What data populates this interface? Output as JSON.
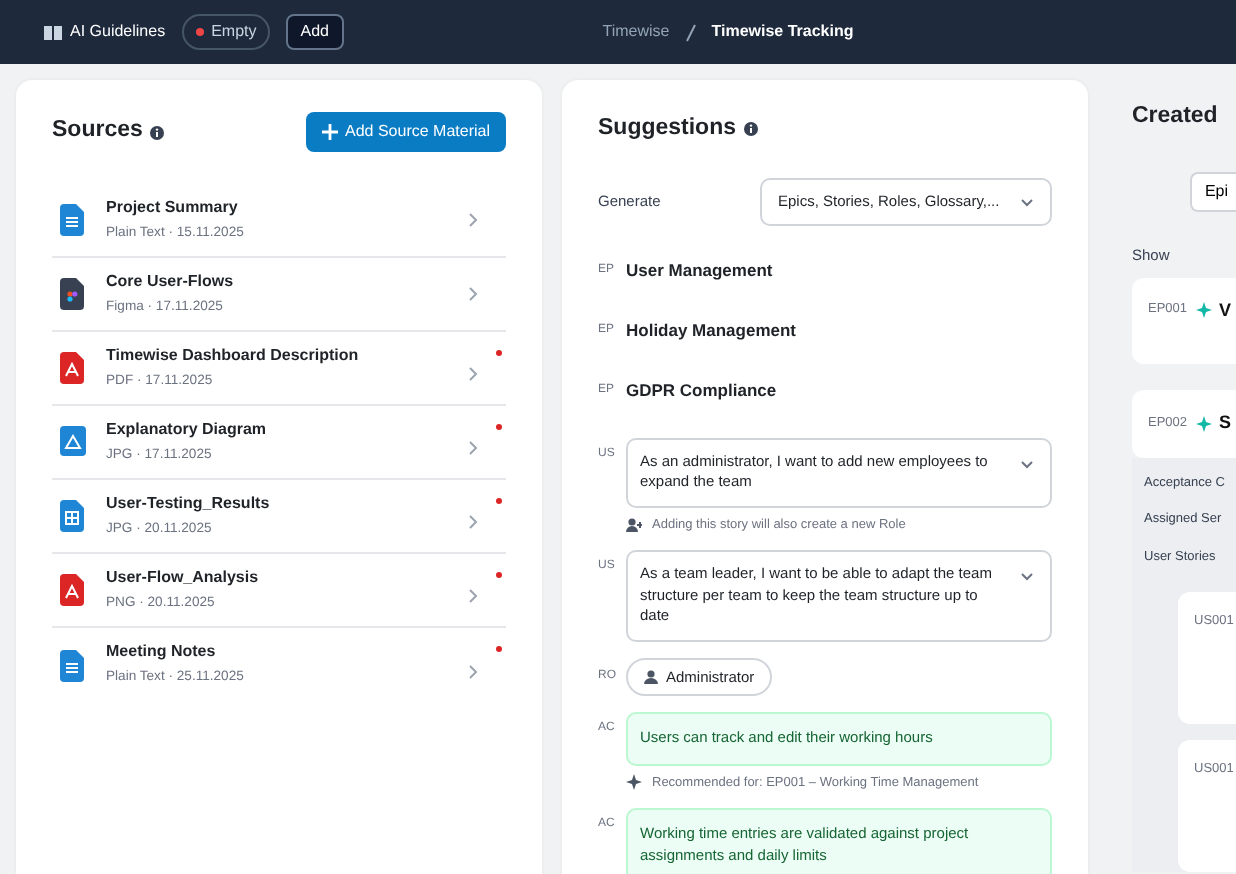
{
  "topbar": {
    "guidelines_label": "AI Guidelines",
    "status_badge": "Empty",
    "add_button": "Add",
    "breadcrumb": [
      "Timewise",
      "Timewise Tracking"
    ]
  },
  "sources": {
    "title": "Sources",
    "add_button": "Add Source Material",
    "items": [
      {
        "kind": "text",
        "title": "Project Summary",
        "meta": "Plain Text · 15.11.2025",
        "unread": false
      },
      {
        "kind": "figma",
        "title": "Core User-Flows",
        "meta": "Figma · 17.11.2025",
        "unread": false
      },
      {
        "kind": "pdf",
        "title": "Timewise Dashboard Description",
        "meta": "PDF · 17.11.2025",
        "unread": true
      },
      {
        "kind": "diagram",
        "title": "Explanatory Diagram",
        "meta": "JPG · 17.11.2025",
        "unread": true
      },
      {
        "kind": "table",
        "title": "User-Testing_Results",
        "meta": "JPG · 20.11.2025",
        "unread": true
      },
      {
        "kind": "pdf",
        "title": "User-Flow_Analysis",
        "meta": "PNG · 20.11.2025",
        "unread": true
      },
      {
        "kind": "text",
        "title": "Meeting Notes",
        "meta": "Plain Text · 25.11.2025",
        "unread": true
      }
    ]
  },
  "suggestions": {
    "title": "Suggestions",
    "generate_label": "Generate",
    "generate_value": "Epics, Stories, Roles, Glossary,...",
    "items": [
      {
        "kind": "epic",
        "tag": "EP",
        "text": "User Management"
      },
      {
        "kind": "epic",
        "tag": "EP",
        "text": "Holiday Management"
      },
      {
        "kind": "epic",
        "tag": "EP",
        "text": "GDPR Compliance"
      },
      {
        "kind": "story",
        "tag": "US",
        "text": "As an administrator, I want to add new employees to expand the team",
        "note": "Adding this story will also create a new Role"
      },
      {
        "kind": "story",
        "tag": "US",
        "text": "As a team leader, I want to be able to adapt the team structure per team to keep the team structure up to date"
      },
      {
        "kind": "role",
        "tag": "RO",
        "text": "Administrator"
      },
      {
        "kind": "criterion",
        "tag": "AC",
        "text": "Users can track and edit their working hours",
        "note": "Recommended for: EP001 – Working Time Management"
      },
      {
        "kind": "criterion",
        "tag": "AC",
        "text": "Working time entries are validated against project assignments and daily limits"
      }
    ]
  },
  "created": {
    "title": "Created",
    "filter_button": "Epi",
    "show_label": "Show",
    "epics": [
      {
        "id": "EP001",
        "title": "V",
        "expanded": false
      },
      {
        "id": "EP002",
        "title": "S",
        "expanded": true,
        "sections": [
          "Acceptance C",
          "Assigned Ser",
          "User Stories"
        ],
        "stories": [
          "US001",
          "US001"
        ]
      }
    ]
  }
}
